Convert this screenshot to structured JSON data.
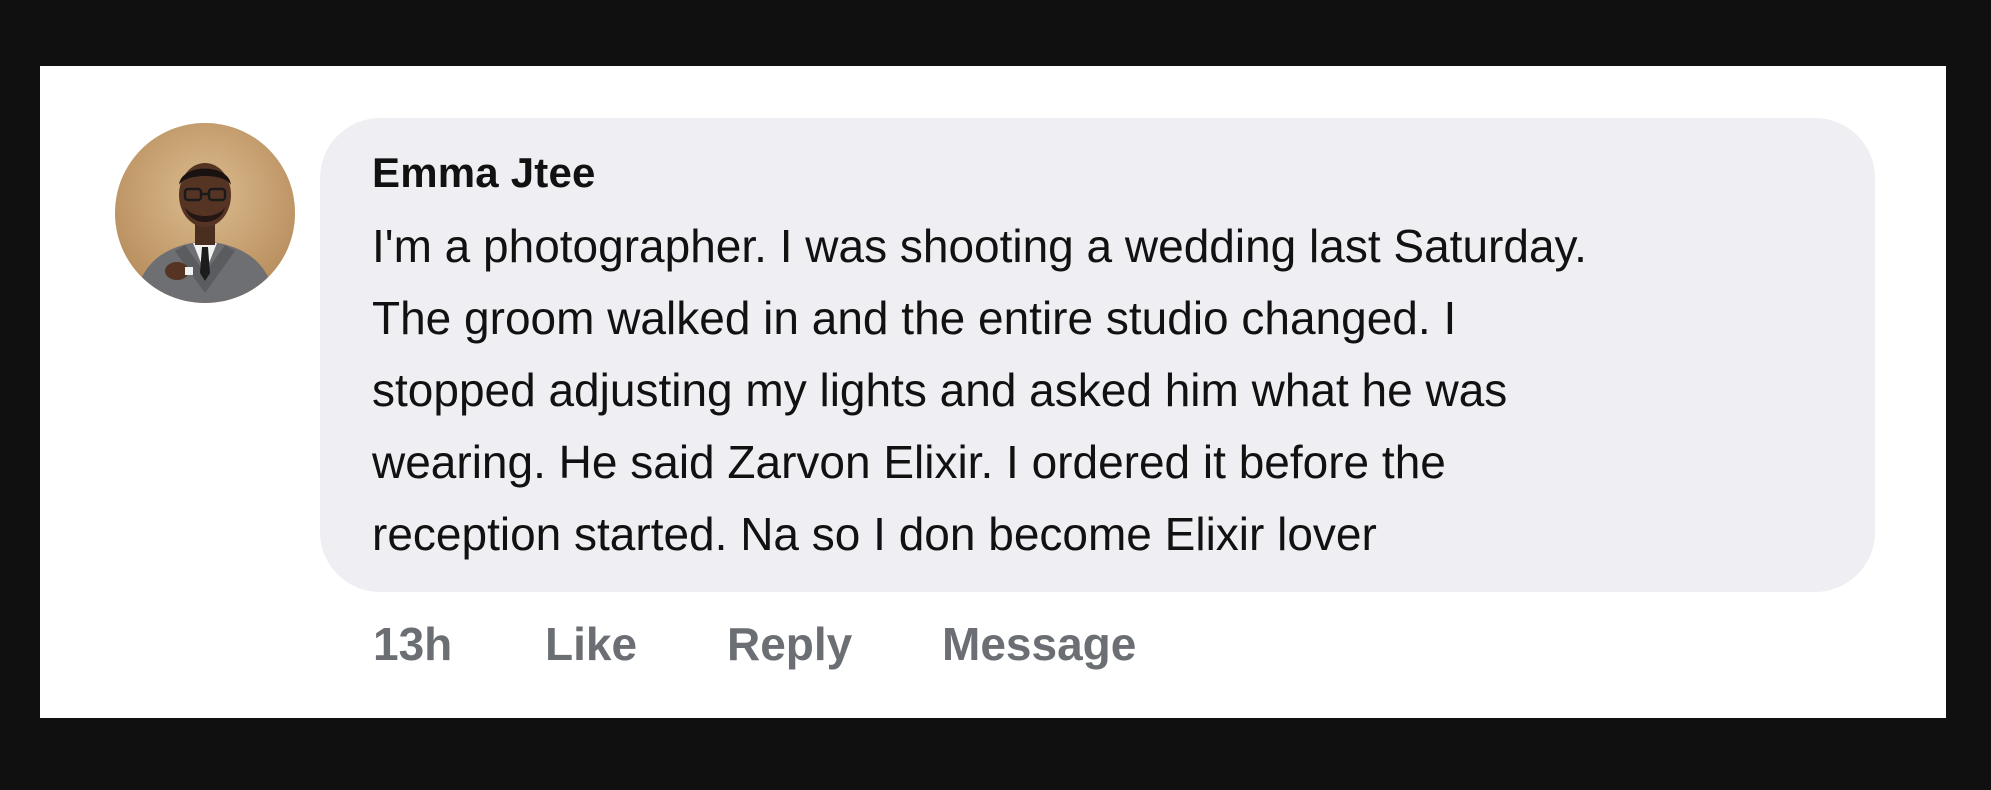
{
  "comment": {
    "author": "Emma Jtee",
    "lines": [
      "I'm a photographer. I was shooting a wedding last Saturday.",
      "The groom walked in and the entire studio changed. I",
      "stopped adjusting my lights and asked him what he was",
      "wearing. He said Zarvon Elixir. I ordered it before the",
      "reception started. Na so I don become Elixir lover"
    ],
    "timestamp": "13h",
    "actions": {
      "like": "Like",
      "reply": "Reply",
      "message": "Message"
    }
  },
  "colors": {
    "frame": "#101010",
    "card": "#ffffff",
    "bubble": "#efeff3",
    "text": "#111111",
    "muted": "#6b6e73"
  },
  "icons": {
    "avatar": "avatar-photo-man-in-suit"
  }
}
